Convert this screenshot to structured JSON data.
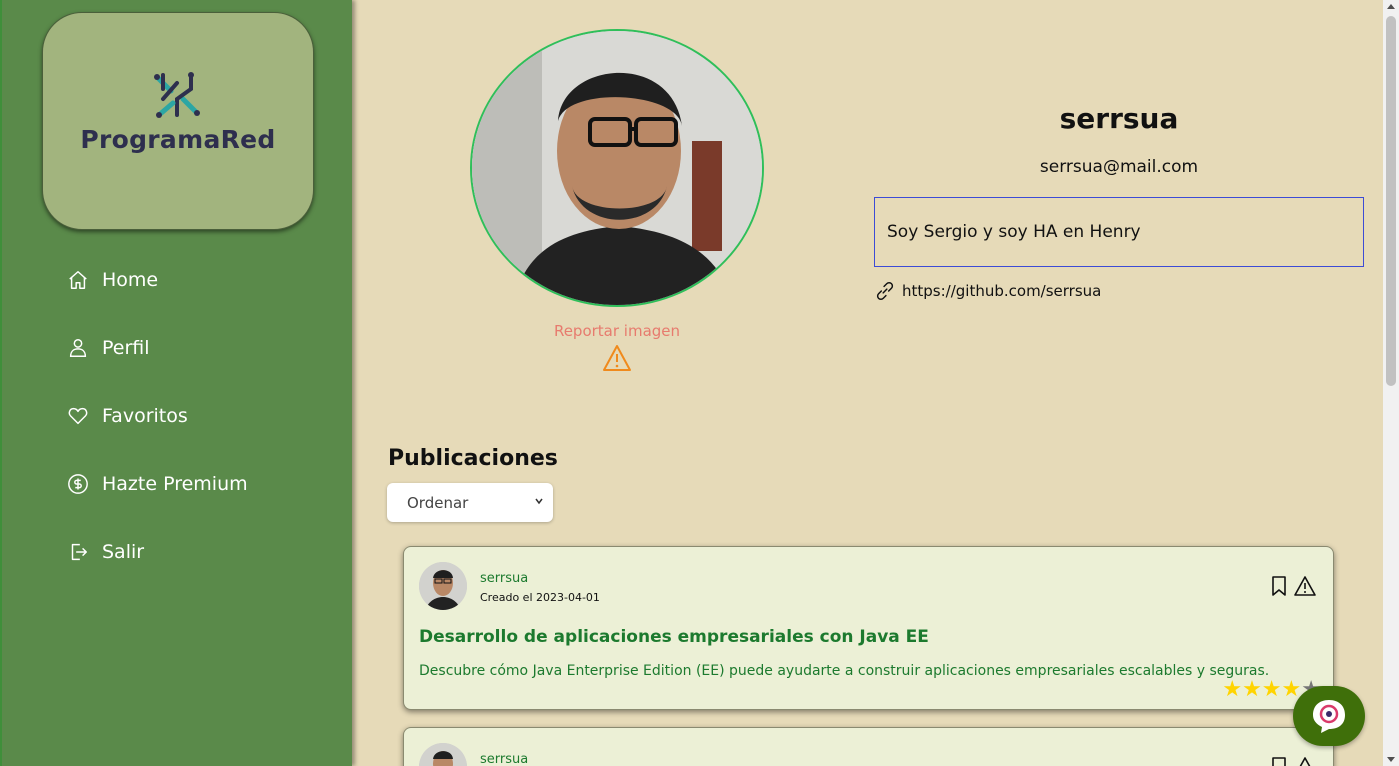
{
  "brand": {
    "name": "ProgramaRed"
  },
  "sidebar": {
    "items": [
      {
        "label": "Home",
        "icon": "home-icon"
      },
      {
        "label": "Perfil",
        "icon": "user-icon"
      },
      {
        "label": "Favoritos",
        "icon": "heart-icon"
      },
      {
        "label": "Hazte Premium",
        "icon": "dollar-icon"
      },
      {
        "label": "Salir",
        "icon": "logout-icon"
      }
    ]
  },
  "profile": {
    "username": "serrsua",
    "email": "serrsua@mail.com",
    "bio": "Soy Sergio y soy HA en Henry",
    "link": "https://github.com/serrsua",
    "report_label": "Reportar imagen"
  },
  "publications": {
    "title": "Publicaciones",
    "sort_label": "Ordenar",
    "posts": [
      {
        "author": "serrsua",
        "date": "Creado el 2023-04-01",
        "title": "Desarrollo de aplicaciones empresariales con Java EE",
        "description": "Descubre cómo Java Enterprise Edition (EE) puede ayudarte a construir aplicaciones empresariales escalables y seguras.",
        "rating": 4,
        "rating_max": 5
      },
      {
        "author": "serrsua"
      }
    ]
  },
  "colors": {
    "sidebar": "#5a8a4a",
    "background": "#e6dab8",
    "accent_green": "#1c7a2e",
    "report": "#e77b6e",
    "card": "#ecf0d6"
  }
}
